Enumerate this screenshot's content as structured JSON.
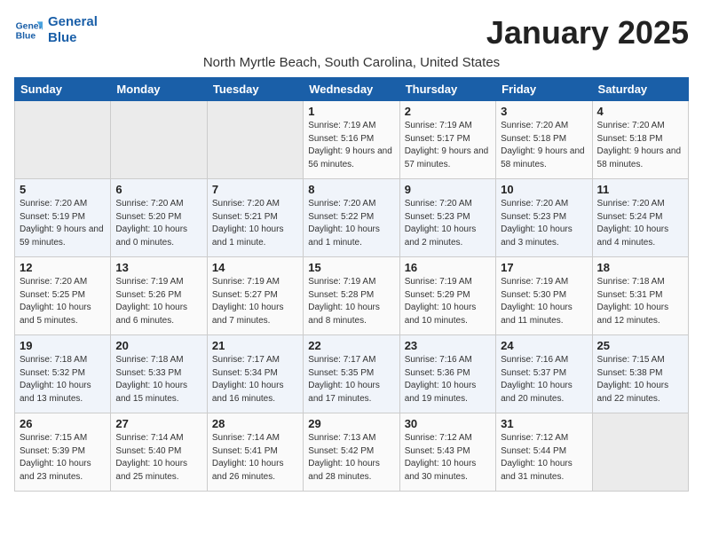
{
  "header": {
    "logo_line1": "General",
    "logo_line2": "Blue",
    "month": "January 2025",
    "subtitle": "North Myrtle Beach, South Carolina, United States"
  },
  "days_of_week": [
    "Sunday",
    "Monday",
    "Tuesday",
    "Wednesday",
    "Thursday",
    "Friday",
    "Saturday"
  ],
  "weeks": [
    [
      {
        "day": "",
        "empty": true
      },
      {
        "day": "",
        "empty": true
      },
      {
        "day": "",
        "empty": true
      },
      {
        "day": "1",
        "sunrise": "7:19 AM",
        "sunset": "5:16 PM",
        "daylight": "9 hours and 56 minutes."
      },
      {
        "day": "2",
        "sunrise": "7:19 AM",
        "sunset": "5:17 PM",
        "daylight": "9 hours and 57 minutes."
      },
      {
        "day": "3",
        "sunrise": "7:20 AM",
        "sunset": "5:18 PM",
        "daylight": "9 hours and 58 minutes."
      },
      {
        "day": "4",
        "sunrise": "7:20 AM",
        "sunset": "5:18 PM",
        "daylight": "9 hours and 58 minutes."
      }
    ],
    [
      {
        "day": "5",
        "sunrise": "7:20 AM",
        "sunset": "5:19 PM",
        "daylight": "9 hours and 59 minutes."
      },
      {
        "day": "6",
        "sunrise": "7:20 AM",
        "sunset": "5:20 PM",
        "daylight": "10 hours and 0 minutes."
      },
      {
        "day": "7",
        "sunrise": "7:20 AM",
        "sunset": "5:21 PM",
        "daylight": "10 hours and 1 minute."
      },
      {
        "day": "8",
        "sunrise": "7:20 AM",
        "sunset": "5:22 PM",
        "daylight": "10 hours and 1 minute."
      },
      {
        "day": "9",
        "sunrise": "7:20 AM",
        "sunset": "5:23 PM",
        "daylight": "10 hours and 2 minutes."
      },
      {
        "day": "10",
        "sunrise": "7:20 AM",
        "sunset": "5:23 PM",
        "daylight": "10 hours and 3 minutes."
      },
      {
        "day": "11",
        "sunrise": "7:20 AM",
        "sunset": "5:24 PM",
        "daylight": "10 hours and 4 minutes."
      }
    ],
    [
      {
        "day": "12",
        "sunrise": "7:20 AM",
        "sunset": "5:25 PM",
        "daylight": "10 hours and 5 minutes."
      },
      {
        "day": "13",
        "sunrise": "7:19 AM",
        "sunset": "5:26 PM",
        "daylight": "10 hours and 6 minutes."
      },
      {
        "day": "14",
        "sunrise": "7:19 AM",
        "sunset": "5:27 PM",
        "daylight": "10 hours and 7 minutes."
      },
      {
        "day": "15",
        "sunrise": "7:19 AM",
        "sunset": "5:28 PM",
        "daylight": "10 hours and 8 minutes."
      },
      {
        "day": "16",
        "sunrise": "7:19 AM",
        "sunset": "5:29 PM",
        "daylight": "10 hours and 10 minutes."
      },
      {
        "day": "17",
        "sunrise": "7:19 AM",
        "sunset": "5:30 PM",
        "daylight": "10 hours and 11 minutes."
      },
      {
        "day": "18",
        "sunrise": "7:18 AM",
        "sunset": "5:31 PM",
        "daylight": "10 hours and 12 minutes."
      }
    ],
    [
      {
        "day": "19",
        "sunrise": "7:18 AM",
        "sunset": "5:32 PM",
        "daylight": "10 hours and 13 minutes."
      },
      {
        "day": "20",
        "sunrise": "7:18 AM",
        "sunset": "5:33 PM",
        "daylight": "10 hours and 15 minutes."
      },
      {
        "day": "21",
        "sunrise": "7:17 AM",
        "sunset": "5:34 PM",
        "daylight": "10 hours and 16 minutes."
      },
      {
        "day": "22",
        "sunrise": "7:17 AM",
        "sunset": "5:35 PM",
        "daylight": "10 hours and 17 minutes."
      },
      {
        "day": "23",
        "sunrise": "7:16 AM",
        "sunset": "5:36 PM",
        "daylight": "10 hours and 19 minutes."
      },
      {
        "day": "24",
        "sunrise": "7:16 AM",
        "sunset": "5:37 PM",
        "daylight": "10 hours and 20 minutes."
      },
      {
        "day": "25",
        "sunrise": "7:15 AM",
        "sunset": "5:38 PM",
        "daylight": "10 hours and 22 minutes."
      }
    ],
    [
      {
        "day": "26",
        "sunrise": "7:15 AM",
        "sunset": "5:39 PM",
        "daylight": "10 hours and 23 minutes."
      },
      {
        "day": "27",
        "sunrise": "7:14 AM",
        "sunset": "5:40 PM",
        "daylight": "10 hours and 25 minutes."
      },
      {
        "day": "28",
        "sunrise": "7:14 AM",
        "sunset": "5:41 PM",
        "daylight": "10 hours and 26 minutes."
      },
      {
        "day": "29",
        "sunrise": "7:13 AM",
        "sunset": "5:42 PM",
        "daylight": "10 hours and 28 minutes."
      },
      {
        "day": "30",
        "sunrise": "7:12 AM",
        "sunset": "5:43 PM",
        "daylight": "10 hours and 30 minutes."
      },
      {
        "day": "31",
        "sunrise": "7:12 AM",
        "sunset": "5:44 PM",
        "daylight": "10 hours and 31 minutes."
      },
      {
        "day": "",
        "empty": true
      }
    ]
  ]
}
